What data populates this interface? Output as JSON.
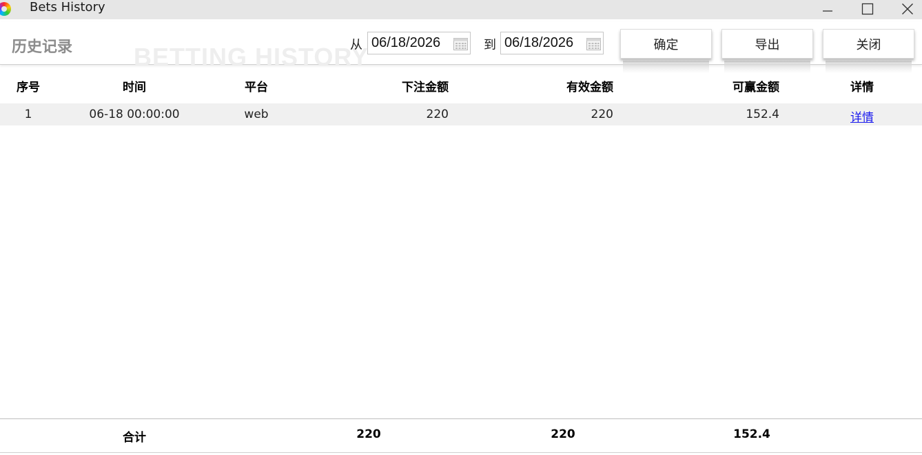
{
  "window": {
    "title": "Bets History",
    "controls": [
      "minimize-icon",
      "maximize-icon",
      "close-icon"
    ]
  },
  "header": {
    "title": "历史记录",
    "watermark": "BETTING HISTORY",
    "from_label": "从",
    "to_label": "到",
    "from_date": "06/18/2026",
    "to_date": "06/18/2026",
    "buttons": {
      "confirm": "确定",
      "export": "导出",
      "close": "关闭"
    }
  },
  "table": {
    "columns": [
      "序号",
      "时间",
      "平台",
      "下注金额",
      "有效金额",
      "可赢金额",
      "详情"
    ],
    "rows": [
      {
        "index": "1",
        "time": "06-18 00:00:00",
        "platform": "web",
        "bet_amount": "220",
        "valid_amount": "220",
        "win_amount": "152.4",
        "detail": "详情"
      }
    ]
  },
  "totals": {
    "label": "合计",
    "bet_amount": "220",
    "valid_amount": "220",
    "win_amount": "152.4"
  },
  "colors": {
    "titlebar_bg": "#e6e6e6",
    "row_bg": "#f0f0f0",
    "link": "#1a1aee",
    "header_title": "#8c8c8c"
  }
}
